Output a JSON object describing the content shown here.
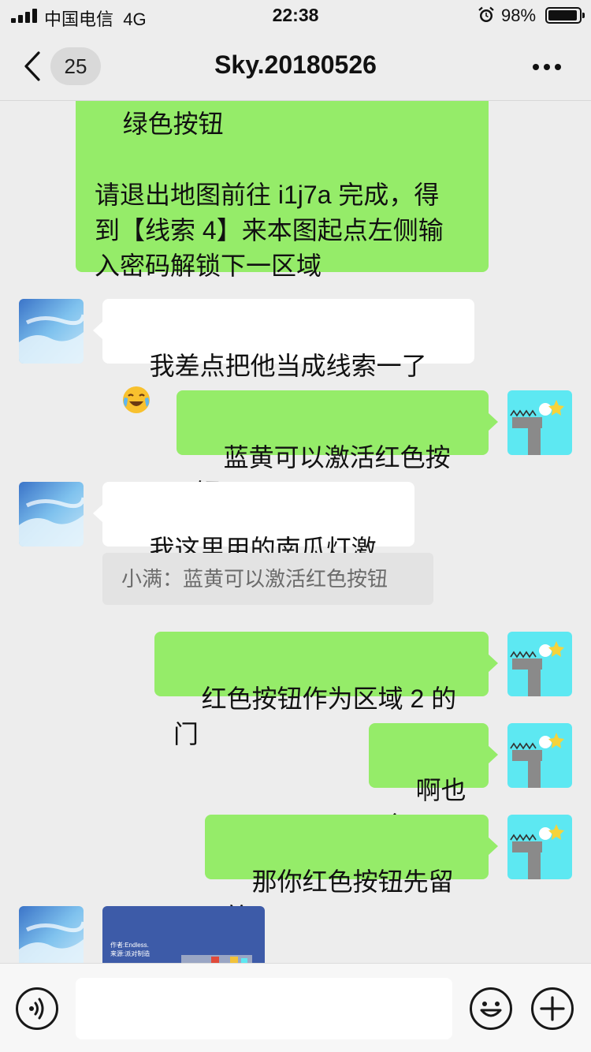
{
  "status_bar": {
    "carrier": "中国电信",
    "network": "4G",
    "time": "22:38",
    "battery": "98%"
  },
  "nav": {
    "unread_count": "25",
    "title": "Sky.20180526"
  },
  "messages": [
    {
      "id": "m1",
      "side": "out",
      "text": "绿色按钮\n\n请退出地图前往 i1j7a 完成，得\n到【线索 4】来本图起点左侧输\n入密码解锁下一区域"
    },
    {
      "id": "m2",
      "side": "in",
      "text": "我差点把他当成线索一了",
      "emoji": "loudly-crying-laughing-emoji"
    },
    {
      "id": "m3",
      "side": "out",
      "text": "蓝黄可以激活红色按钮"
    },
    {
      "id": "m4",
      "side": "in",
      "text": "我这里用的南瓜灯激活"
    },
    {
      "id": "m4q",
      "type": "quote",
      "text": "小满：蓝黄可以激活红色按钮"
    },
    {
      "id": "m5",
      "side": "out",
      "text": "红色按钮作为区域 2 的门"
    },
    {
      "id": "m6",
      "side": "out",
      "text": "啊也行"
    },
    {
      "id": "m7",
      "side": "out",
      "text": "那你红色按钮先留着"
    },
    {
      "id": "m8",
      "side": "in",
      "type": "image",
      "caption_line1": "作者:Endless.",
      "caption_line2": "来源:派对制造"
    }
  ],
  "input_bar": {
    "voice_icon": "voice-icon",
    "emoji_icon": "smiley-icon",
    "plus_icon": "plus-icon",
    "text_value": ""
  },
  "colors": {
    "background": "#ededed",
    "outgoing_bubble": "#95ec69",
    "incoming_bubble": "#ffffff",
    "quote_bg": "#e3e3e3"
  }
}
